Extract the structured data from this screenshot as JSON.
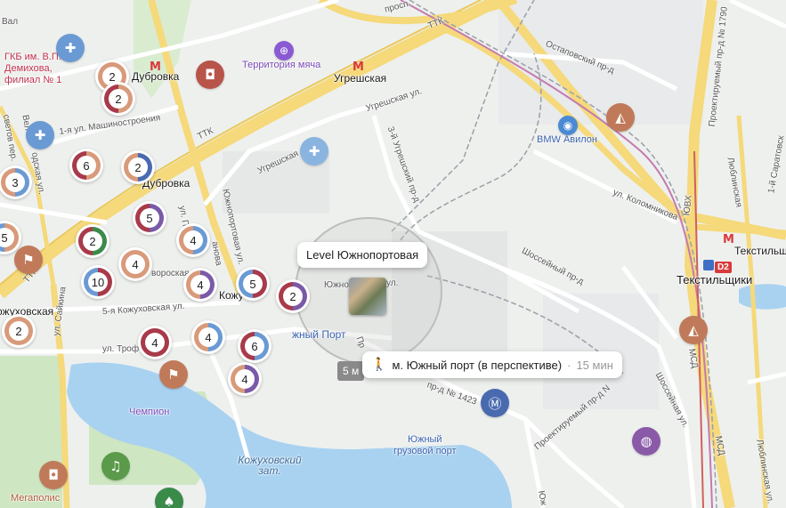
{
  "colors": {
    "major_road": "#f5d97a",
    "minor_road": "#ffffff",
    "water": "#a9d2f0",
    "park": "#cfe6c2",
    "rail": "#9aa0a8",
    "rail_accent": "#c47ab0",
    "cluster_green": "#3a8a4a",
    "cluster_orange": "#d89a7a",
    "cluster_purple": "#7a5aa8",
    "cluster_blue": "#6a9ad4",
    "cluster_red": "#a83a4a"
  },
  "title_bubble": {
    "text": "Level Южнопортовая"
  },
  "route_bubble": {
    "icon": "walking-person-icon",
    "station": "м. Южный порт (в перспективе)",
    "separator": "·",
    "duration": "15 мин"
  },
  "time_chip": {
    "text": "5 м"
  },
  "metro_labels": {
    "dubrovka": "Дубровка",
    "dubrovka2": "Дубровка",
    "ugreshskaya": "Угрешская",
    "tekstilshchiki": "Текстильщики",
    "tekstilshchiki2": "Текстильщики",
    "kozhukhovskaya": "Кожу",
    "kozhukhovskaya2": "ожуховская",
    "yuzhny_port": "жный Порт",
    "metro_symbol": "М",
    "d2": "D2"
  },
  "poi_labels": {
    "hospital": "ГКБ им. В.П.\nДемихова,\nфилиал № 1",
    "territory": "Территория мяча",
    "bmw": "BMW Авилон",
    "champion": "Чемпион",
    "megapolis": "Мегаполис",
    "yuzhny_gruz_port": "Южный\nгрузовой порт"
  },
  "water_labels": {
    "kozh_zaton": "Кожуховский\nзат."
  },
  "road_labels": {
    "ttk1": "ТТК",
    "ttk2": "ТТК",
    "ttk3": "ТТК",
    "prosp": "просп.",
    "ostapovsky": "Остаповский пр-д",
    "ugreshskaya_ul": "Угрешская ул.",
    "ugreshskaya_ul2": "Угрешская",
    "3ugresh": "3-й Угрешский пр-д",
    "mashinostr": "1-я ул. Машиностроения",
    "kolomnikova": "ул. Коломникова",
    "shosseyny": "Шоссейный пр-д",
    "shosseynaya": "Шоссейная ул.",
    "yuzhnoport": "Южнопортовая ул.",
    "yuzhnoport2": "Южно",
    "yuzhnoport3": "ул.",
    "kozh5": "5-я Кожуховская ул.",
    "troff": "ул. Троф",
    "saykina": "ул. Сайкина",
    "ul_val": "Вал",
    "vel": "Вел",
    "odsk": "одская ул.",
    "svetov": "светов пер.",
    "proektir": "Проектируемый пр-д № 1790",
    "proektir2": "Проектируемый пр-д N",
    "pr1423": "пр-д № 1423",
    "lyublin": "Люблинская",
    "lyublin2": "Люблинская ул.",
    "saratov": "1-й Саратовск",
    "uvh": "ЮВХ",
    "mcd": "МСД",
    "mcd2": "МСД",
    "ukh": "Юж",
    "ukh2": "ул.",
    "ukh3": "Юж",
    "vozh": "вская ул.",
    "vozh2": "зозавод",
    "ul": "ул.",
    "ul2": "ул.",
    "pr": "Пр",
    "ana": "анова",
    "ul_p": "ул. П",
    "vorosk": "вороская ул."
  },
  "clusters": [
    {
      "label": "2",
      "colors": [
        "#d89a7a",
        "#d89a7a"
      ]
    },
    {
      "label": "2",
      "colors": [
        "#d89a7a",
        "#a83a4a"
      ]
    },
    {
      "label": "6",
      "colors": [
        "#d89a7a",
        "#a83a4a"
      ]
    },
    {
      "label": "2",
      "colors": [
        "#4a6ab0",
        "#d89a7a"
      ]
    },
    {
      "label": "3",
      "colors": [
        "#6a9ad4",
        "#d89a7a"
      ]
    },
    {
      "label": "5",
      "colors": [
        "#7a5aa8",
        "#a83a4a"
      ]
    },
    {
      "label": "5",
      "colors": [
        "#d89a7a",
        "#6a9ad4"
      ]
    },
    {
      "label": "2",
      "colors": [
        "#3a8a4a",
        "#a83a4a"
      ]
    },
    {
      "label": "4",
      "colors": [
        "#6a9ad4",
        "#d89a7a"
      ]
    },
    {
      "label": "4",
      "colors": [
        "#d89a7a",
        "#d89a7a"
      ]
    },
    {
      "label": "10",
      "colors": [
        "#a83a4a",
        "#6a9ad4"
      ]
    },
    {
      "label": "4",
      "colors": [
        "#7a5aa8",
        "#d89a7a"
      ]
    },
    {
      "label": "5",
      "colors": [
        "#a83a4a",
        "#6a9ad4"
      ]
    },
    {
      "label": "2",
      "colors": [
        "#7a5aa8",
        "#a83a4a"
      ]
    },
    {
      "label": "2",
      "colors": [
        "#d89a7a",
        "#d89a7a"
      ]
    },
    {
      "label": "4",
      "colors": [
        "#a83a4a",
        "#a83a4a"
      ]
    },
    {
      "label": "4",
      "colors": [
        "#6a9ad4",
        "#d89a7a"
      ]
    },
    {
      "label": "6",
      "colors": [
        "#6a9ad4",
        "#a83a4a"
      ]
    },
    {
      "label": "4",
      "colors": [
        "#7a5aa8",
        "#d89a7a"
      ]
    }
  ],
  "pins": [
    {
      "icon": "medical-cross-icon",
      "glyph": "✚",
      "color": "#6a9ad4"
    },
    {
      "icon": "medical-cross-icon",
      "glyph": "✚",
      "color": "#6a9ad4"
    },
    {
      "icon": "medical-cross-icon",
      "glyph": "✚",
      "color": "#8ab4e0"
    },
    {
      "icon": "shopping-bag-icon",
      "glyph": "◘",
      "color": "#b8544a"
    },
    {
      "icon": "dumbbell-icon",
      "glyph": "⊕",
      "color": "#8a5ad4"
    },
    {
      "icon": "graduation-cap-icon",
      "glyph": "◭",
      "color": "#c07a5a"
    },
    {
      "icon": "car-service-icon",
      "glyph": "◉",
      "color": "#4a8ad4"
    },
    {
      "icon": "graduation-cap-icon",
      "glyph": "◭",
      "color": "#c07a5a"
    },
    {
      "icon": "metro-station-icon",
      "glyph": "Ⓜ",
      "color": "#4a6ab0"
    },
    {
      "icon": "volleyball-icon",
      "glyph": "◍",
      "color": "#8a5aa8"
    },
    {
      "icon": "shopping-bag-icon",
      "glyph": "◘",
      "color": "#c07a5a"
    },
    {
      "icon": "bell-icon",
      "glyph": "♫",
      "color": "#5a9a4a"
    },
    {
      "icon": "theatre-icon",
      "glyph": "♠",
      "color": "#3a8a4a"
    },
    {
      "icon": "flag-icon",
      "glyph": "⚑",
      "color": "#c07a5a"
    },
    {
      "icon": "flag-icon",
      "glyph": "⚑",
      "color": "#c07a5a"
    }
  ]
}
